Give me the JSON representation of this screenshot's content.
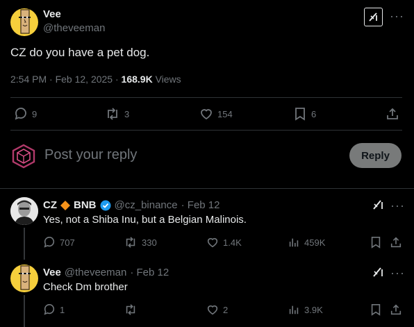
{
  "main_post": {
    "author_name": "Vee",
    "author_handle": "@theveeman",
    "text": "CZ do you have a pet dog.",
    "time": "2:54 PM · Feb 12, 2025 · ",
    "views_count": "168.9K",
    "views_label": " Views",
    "stats": {
      "replies": "9",
      "reposts": "3",
      "likes": "154",
      "bookmarks": "6"
    }
  },
  "composer": {
    "placeholder": "Post your reply",
    "button_label": "Reply"
  },
  "replies": [
    {
      "author_name": "CZ",
      "badge": "BNB",
      "handle": "@cz_binance",
      "date": "· Feb 12",
      "text": "Yes, not a Shiba Inu, but a Belgian Malinois.",
      "replies": "707",
      "reposts": "330",
      "likes": "1.4K",
      "views": "459K"
    },
    {
      "author_name": "Vee",
      "handle": "@theveeman",
      "date": "· Feb 12",
      "text": "Check Dm brother",
      "replies": "1",
      "reposts": "",
      "likes": "2",
      "views": "3.9K"
    }
  ],
  "colors": {
    "background": "#000000",
    "text": "#e7e9ea",
    "muted": "#71767b",
    "verified": "#1d9bf0",
    "binance_orange": "#f0b90b",
    "avatar_yellow": "#f6cf3c"
  },
  "icons": [
    "grok-icon",
    "more-icon",
    "reply-icon",
    "repost-icon",
    "like-icon",
    "bookmark-icon",
    "share-icon",
    "views-icon",
    "verified-icon",
    "binance-diamond-icon"
  ]
}
